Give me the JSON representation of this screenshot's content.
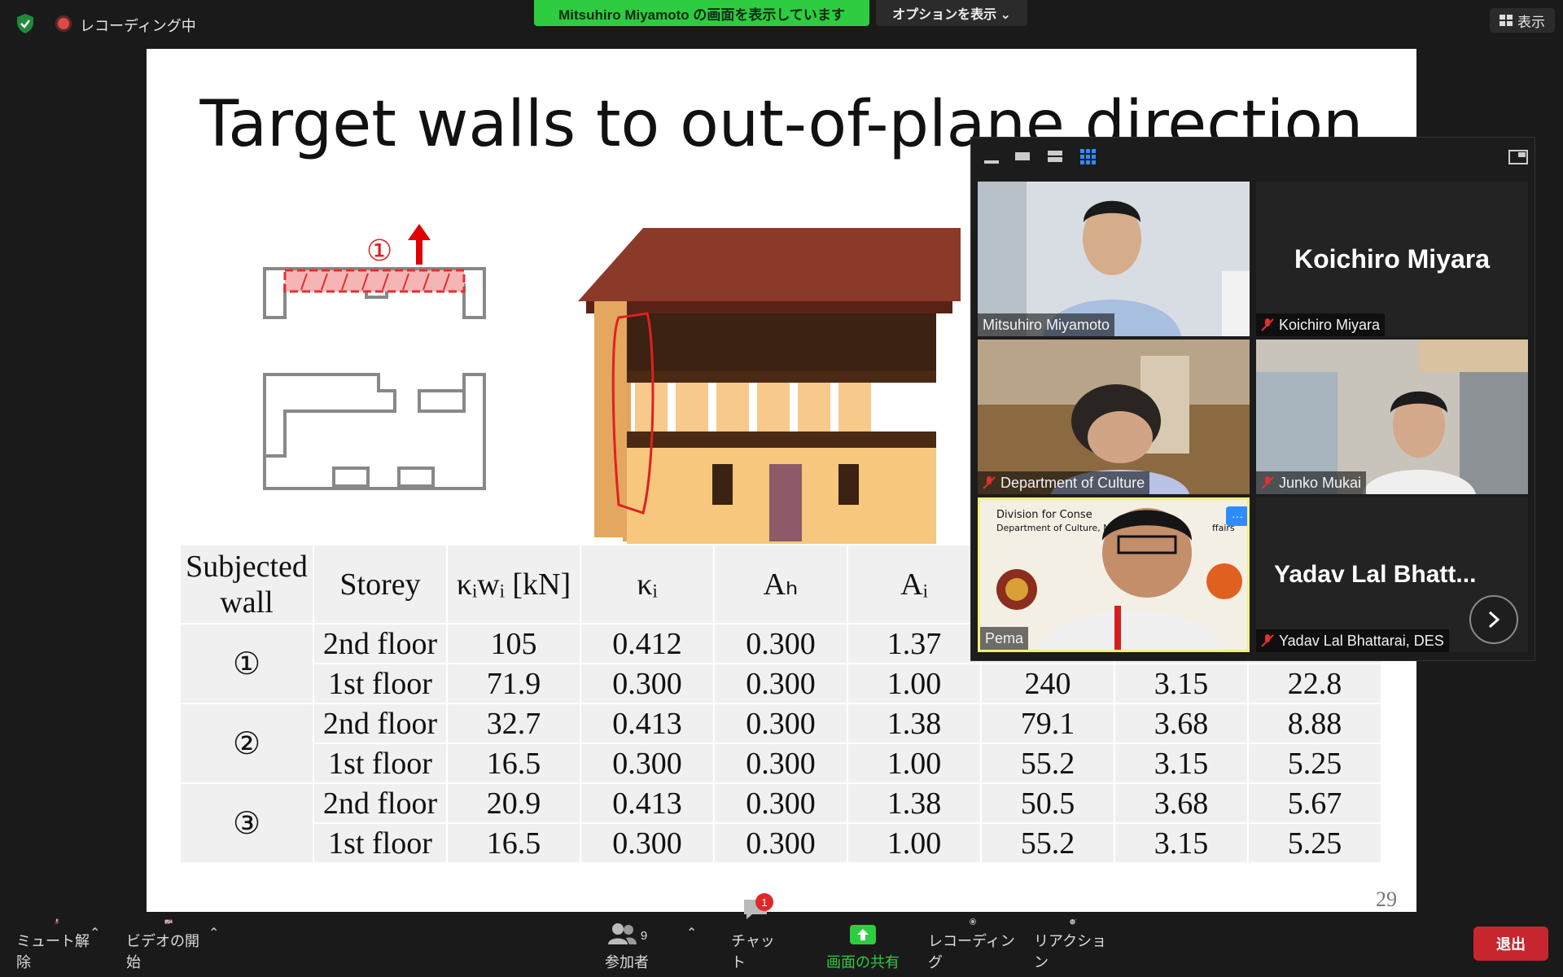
{
  "top": {
    "recording": "レコーディング中",
    "share_banner": "Mitsuhiro  Miyamoto の画面を表示しています",
    "options": "オプションを表示 ⌄",
    "view": "表示"
  },
  "slide": {
    "title": "Target walls to out-of-plane direction",
    "plan_marker": "①",
    "page_number": "29",
    "table": {
      "headers": [
        "Subjected wall",
        "Storey",
        "κᵢwᵢ [kN]",
        "κᵢ",
        "Aₕ",
        "Aᵢ",
        "",
        "",
        ""
      ],
      "header_line1": "Subjected",
      "header_line2": "wall",
      "groups": [
        {
          "wall": "①",
          "rows": [
            [
              "2nd floor",
              "105",
              "0.412",
              "0.300",
              "1.37",
              "",
              "",
              ""
            ],
            [
              "1st floor",
              "71.9",
              "0.300",
              "0.300",
              "1.00",
              "240",
              "3.15",
              "22.8"
            ]
          ]
        },
        {
          "wall": "②",
          "rows": [
            [
              "2nd floor",
              "32.7",
              "0.413",
              "0.300",
              "1.38",
              "79.1",
              "3.68",
              "8.88"
            ],
            [
              "1st floor",
              "16.5",
              "0.300",
              "0.300",
              "1.00",
              "55.2",
              "3.15",
              "5.25"
            ]
          ]
        },
        {
          "wall": "③",
          "rows": [
            [
              "2nd floor",
              "20.9",
              "0.413",
              "0.300",
              "1.38",
              "50.5",
              "3.68",
              "5.67"
            ],
            [
              "1st floor",
              "16.5",
              "0.300",
              "0.300",
              "1.00",
              "55.2",
              "3.15",
              "5.25"
            ]
          ]
        }
      ]
    }
  },
  "gallery": {
    "tiles": [
      {
        "name": "Mitsuhiro Miyamoto",
        "big": "",
        "muted": false
      },
      {
        "name": "Koichiro Miyara",
        "big": "Koichiro Miyara",
        "muted": true
      },
      {
        "name": "Department of Culture",
        "big": "",
        "muted": true
      },
      {
        "name": "Junko Mukai",
        "big": "",
        "muted": true
      },
      {
        "name": "Pema",
        "big": "",
        "muted": false
      },
      {
        "name": "Yadav Lal Bhattarai, DES",
        "big": "Yadav  Lal  Bhatt...",
        "muted": true
      }
    ],
    "pema_banner_line1": "Division for Conse",
    "pema_banner_line2": "Department of Culture, Mi",
    "pema_banner_right": "s",
    "pema_banner_right2": "ffairs",
    "more": "···"
  },
  "bottom": {
    "unmute": "ミュート解除",
    "video": "ビデオの開始",
    "participants": "参加者",
    "participants_count": "9",
    "chat": "チャット",
    "chat_badge": "1",
    "share": "画面の共有",
    "record": "レコーディング",
    "reactions": "リアクション",
    "leave": "退出"
  },
  "colors": {
    "accent_green": "#2ecc40",
    "leave_red": "#c8262e",
    "zoom_blue": "#2d8cff"
  }
}
